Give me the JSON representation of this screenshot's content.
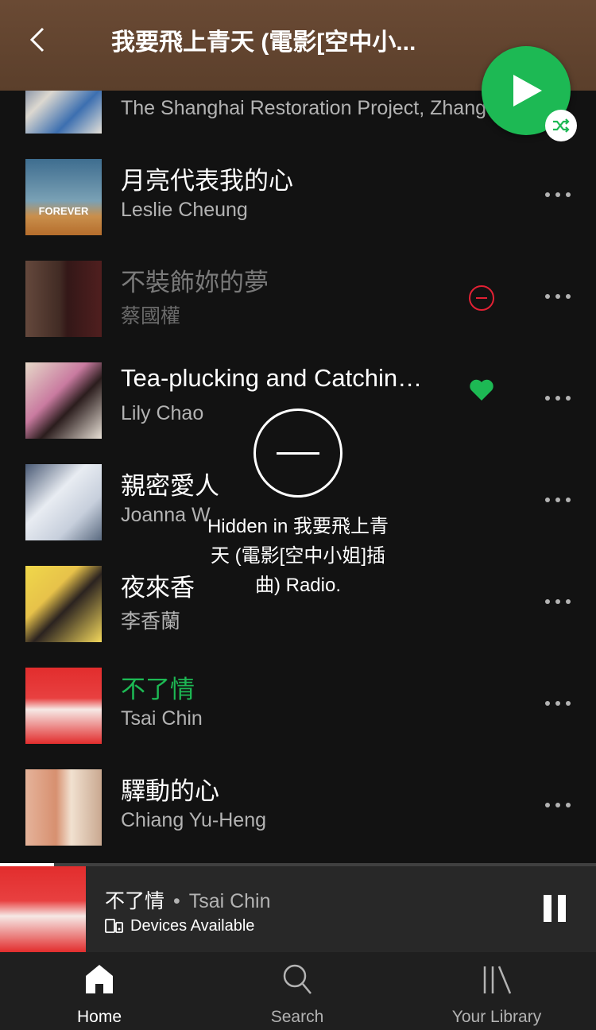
{
  "header": {
    "title": "我要飛上青天 (電影[空中小..."
  },
  "tracks": [
    {
      "title": "",
      "artist": "The Shanghai Restoration Project, Zhang",
      "state": "normal"
    },
    {
      "title": "月亮代表我的心",
      "artist": "Leslie Cheung",
      "state": "normal",
      "art_text": "FOREVER"
    },
    {
      "title": "不裝飾妳的夢",
      "artist": "蔡國權",
      "state": "hidden"
    },
    {
      "title": "Tea-plucking and Catchin…",
      "artist": "Lily Chao",
      "state": "liked"
    },
    {
      "title": "親密愛人",
      "artist": "Joanna W",
      "state": "normal"
    },
    {
      "title": "夜來香",
      "artist": "李香蘭",
      "state": "normal"
    },
    {
      "title": "不了情",
      "artist": "Tsai Chin",
      "state": "playing"
    },
    {
      "title": "驛動的心",
      "artist": "Chiang Yu-Heng",
      "state": "normal"
    }
  ],
  "toast": {
    "text": "Hidden in 我要飛上青天 (電影[空中小姐]插曲) Radio."
  },
  "now_playing": {
    "title": "不了情",
    "separator": "•",
    "artist": "Tsai Chin",
    "device_text": "Devices Available",
    "progress_fraction": 0.09
  },
  "nav": [
    {
      "label": "Home",
      "icon": "home-icon",
      "active": true
    },
    {
      "label": "Search",
      "icon": "search-icon",
      "active": false
    },
    {
      "label": "Your Library",
      "icon": "library-icon",
      "active": false
    }
  ],
  "colors": {
    "accent": "#1db954",
    "hidden_red": "#e22134",
    "header_bg": "#5b3f2b"
  }
}
